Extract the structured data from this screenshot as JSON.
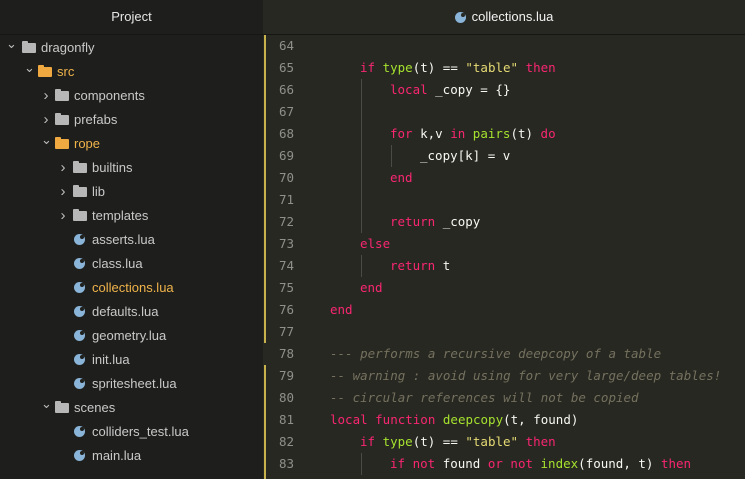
{
  "sidebar": {
    "title": "Project",
    "tree": [
      {
        "label": "dragonfly",
        "type": "folder",
        "expanded": true,
        "depth": 0,
        "color": "gray"
      },
      {
        "label": "src",
        "type": "folder",
        "expanded": true,
        "depth": 1,
        "color": "orange",
        "active": true
      },
      {
        "label": "components",
        "type": "folder",
        "expanded": false,
        "depth": 2,
        "color": "gray"
      },
      {
        "label": "prefabs",
        "type": "folder",
        "expanded": false,
        "depth": 2,
        "color": "gray"
      },
      {
        "label": "rope",
        "type": "folder",
        "expanded": true,
        "depth": 2,
        "color": "orange",
        "active": true
      },
      {
        "label": "builtins",
        "type": "folder",
        "expanded": false,
        "depth": 3,
        "color": "gray"
      },
      {
        "label": "lib",
        "type": "folder",
        "expanded": false,
        "depth": 3,
        "color": "gray"
      },
      {
        "label": "templates",
        "type": "folder",
        "expanded": false,
        "depth": 3,
        "color": "gray"
      },
      {
        "label": "asserts.lua",
        "type": "file",
        "depth": 3
      },
      {
        "label": "class.lua",
        "type": "file",
        "depth": 3
      },
      {
        "label": "collections.lua",
        "type": "file",
        "depth": 3,
        "active": true
      },
      {
        "label": "defaults.lua",
        "type": "file",
        "depth": 3
      },
      {
        "label": "geometry.lua",
        "type": "file",
        "depth": 3
      },
      {
        "label": "init.lua",
        "type": "file",
        "depth": 3
      },
      {
        "label": "spritesheet.lua",
        "type": "file",
        "depth": 3
      },
      {
        "label": "scenes",
        "type": "folder",
        "expanded": true,
        "depth": 2,
        "color": "gray"
      },
      {
        "label": "colliders_test.lua",
        "type": "file",
        "depth": 3
      },
      {
        "label": "main.lua",
        "type": "file",
        "depth": 3
      }
    ]
  },
  "tab": {
    "title": "collections.lua"
  },
  "editor": {
    "lines": [
      {
        "n": "64",
        "indent": 1,
        "tokens": []
      },
      {
        "n": "65",
        "indent": 1,
        "tokens": [
          [
            "kw",
            "if "
          ],
          [
            "fn",
            "type"
          ],
          [
            "p",
            "(t) == "
          ],
          [
            "str",
            "\"table\""
          ],
          [
            "kw",
            " then"
          ]
        ]
      },
      {
        "n": "66",
        "indent": 2,
        "tokens": [
          [
            "kw",
            "local "
          ],
          [
            "p",
            "_copy = {}"
          ]
        ]
      },
      {
        "n": "67",
        "indent": 2,
        "tokens": []
      },
      {
        "n": "68",
        "indent": 2,
        "tokens": [
          [
            "kw",
            "for "
          ],
          [
            "p",
            "k,v "
          ],
          [
            "kw",
            "in "
          ],
          [
            "fn",
            "pairs"
          ],
          [
            "p",
            "(t) "
          ],
          [
            "kw",
            "do"
          ]
        ]
      },
      {
        "n": "69",
        "indent": 3,
        "tokens": [
          [
            "p",
            "_copy[k] = v"
          ]
        ]
      },
      {
        "n": "70",
        "indent": 2,
        "tokens": [
          [
            "kw",
            "end"
          ]
        ]
      },
      {
        "n": "71",
        "indent": 2,
        "tokens": []
      },
      {
        "n": "72",
        "indent": 2,
        "tokens": [
          [
            "kw",
            "return "
          ],
          [
            "p",
            "_copy"
          ]
        ]
      },
      {
        "n": "73",
        "indent": 1,
        "tokens": [
          [
            "kw",
            "else"
          ]
        ]
      },
      {
        "n": "74",
        "indent": 2,
        "tokens": [
          [
            "kw",
            "return "
          ],
          [
            "p",
            "t"
          ]
        ]
      },
      {
        "n": "75",
        "indent": 1,
        "tokens": [
          [
            "kw",
            "end"
          ]
        ]
      },
      {
        "n": "76",
        "indent": 0,
        "tokens": [
          [
            "kw",
            "end"
          ]
        ]
      },
      {
        "n": "77",
        "indent": 0,
        "tokens": []
      },
      {
        "n": "78",
        "indent": 0,
        "tokens": [
          [
            "cm",
            "--- performs a recursive deepcopy of a table"
          ]
        ]
      },
      {
        "n": "79",
        "indent": 0,
        "tokens": [
          [
            "cm",
            "-- warning : avoid using for very large/deep tables!"
          ]
        ]
      },
      {
        "n": "80",
        "indent": 0,
        "tokens": [
          [
            "cm",
            "-- circular references will not be copied"
          ]
        ]
      },
      {
        "n": "81",
        "indent": 0,
        "tokens": [
          [
            "kw",
            "local "
          ],
          [
            "kw",
            "function "
          ],
          [
            "fn",
            "deepcopy"
          ],
          [
            "p",
            "(t, found)"
          ]
        ]
      },
      {
        "n": "82",
        "indent": 1,
        "tokens": [
          [
            "kw",
            "if "
          ],
          [
            "fn",
            "type"
          ],
          [
            "p",
            "(t) == "
          ],
          [
            "str",
            "\"table\""
          ],
          [
            "kw",
            " then"
          ]
        ]
      },
      {
        "n": "83",
        "indent": 2,
        "tokens": [
          [
            "kw",
            "if "
          ],
          [
            "kw",
            "not "
          ],
          [
            "p",
            "found "
          ],
          [
            "kw",
            "or "
          ],
          [
            "kw",
            "not "
          ],
          [
            "fn",
            "index"
          ],
          [
            "p",
            "(found, t) "
          ],
          [
            "kw",
            "then"
          ]
        ]
      }
    ]
  }
}
